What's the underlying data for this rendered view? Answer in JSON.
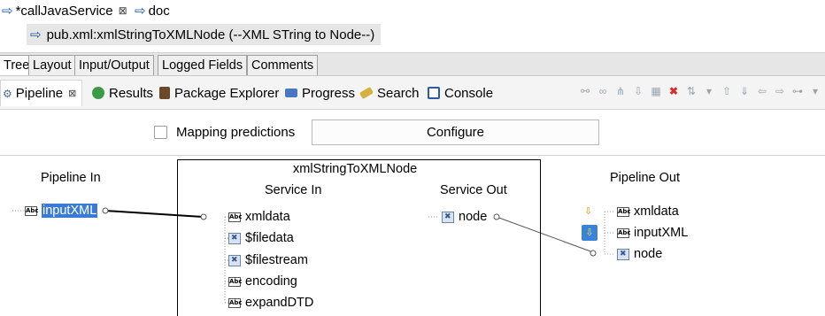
{
  "editor_tabs": [
    {
      "label": "*callJavaService",
      "close": "⊠"
    },
    {
      "label": "doc"
    }
  ],
  "step": {
    "label": "pub.xml:xmlStringToXMLNode (--XML STring to Node--)"
  },
  "view_tabs": [
    "Tree",
    "Layout",
    "Input/Output",
    "Logged Fields",
    "Comments"
  ],
  "views": {
    "pipeline": "Pipeline",
    "pipeline_close": "⊠",
    "results": "Results",
    "package_explorer": "Package Explorer",
    "progress": "Progress",
    "search": "Search",
    "console": "Console"
  },
  "predictions": {
    "label": "Mapping predictions",
    "checked": false,
    "configure": "Configure"
  },
  "pipeline": {
    "in_title": "Pipeline In",
    "out_title": "Pipeline Out",
    "service_title": "xmlStringToXMLNode",
    "service_in": "Service In",
    "service_out": "Service Out",
    "in_vars": [
      {
        "name": "inputXML",
        "type": "Abc",
        "selected": true
      }
    ],
    "service_in_vars": [
      {
        "name": "xmldata",
        "type": "Abc"
      },
      {
        "name": "$filedata",
        "type": "object"
      },
      {
        "name": "$filestream",
        "type": "object"
      },
      {
        "name": "encoding",
        "type": "Abc"
      },
      {
        "name": "expandDTD",
        "type": "Abc"
      }
    ],
    "service_out_vars": [
      {
        "name": "node",
        "type": "object"
      }
    ],
    "out_vars": [
      {
        "name": "xmldata",
        "type": "Abc"
      },
      {
        "name": "inputXML",
        "type": "Abc"
      },
      {
        "name": "node",
        "type": "object"
      }
    ]
  },
  "colors": {
    "accent": "#1e56b0",
    "selection": "#3b7bd4"
  }
}
